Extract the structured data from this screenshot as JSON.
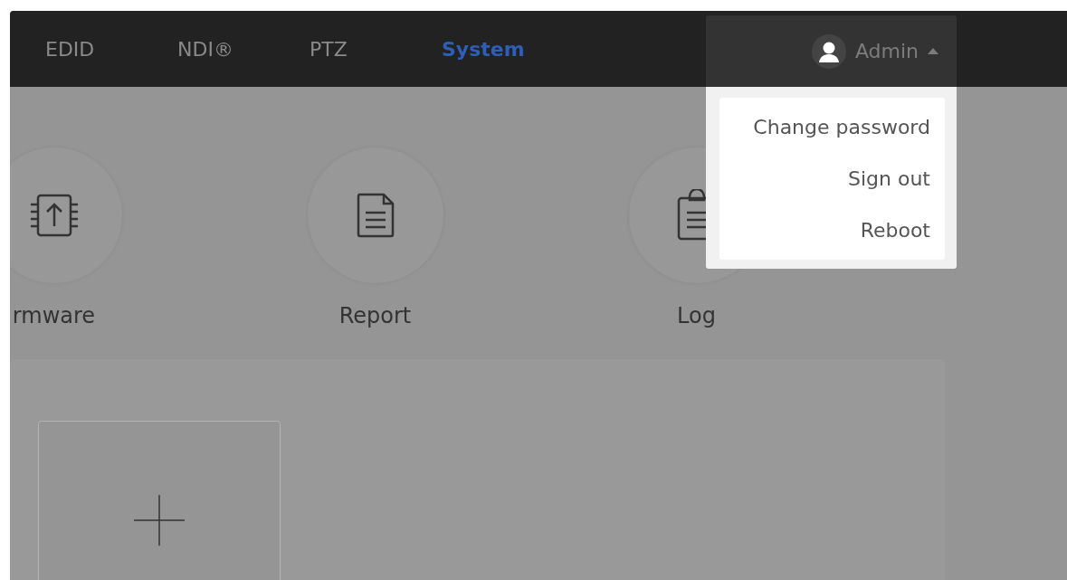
{
  "nav": {
    "tabs": [
      {
        "label": "EDID",
        "selected": false
      },
      {
        "label": "NDI®",
        "selected": false
      },
      {
        "label": "PTZ",
        "selected": false
      },
      {
        "label": "System",
        "selected": true
      }
    ]
  },
  "user": {
    "name": "Admin",
    "expanded": true
  },
  "menu": [
    {
      "label": "Change password"
    },
    {
      "label": "Sign out"
    },
    {
      "label": "Reboot"
    }
  ],
  "tiles": [
    {
      "kind": "firmware",
      "label": "rmware"
    },
    {
      "kind": "report",
      "label": "Report"
    },
    {
      "kind": "log",
      "label": "Log"
    }
  ]
}
